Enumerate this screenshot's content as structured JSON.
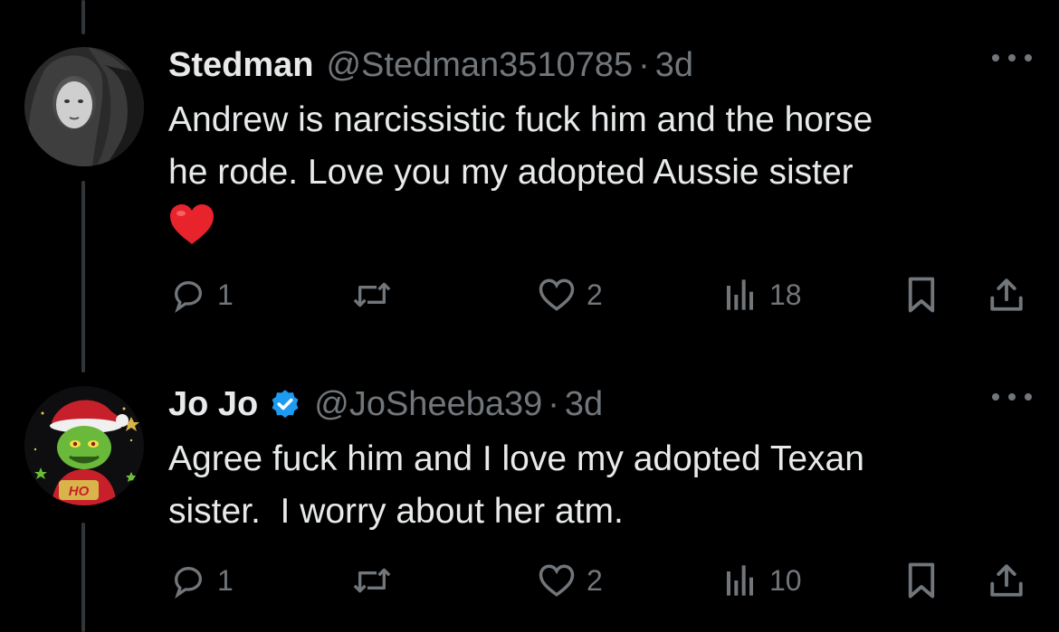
{
  "tweets": [
    {
      "name": "Stedman",
      "handle": "@Stedman3510785",
      "separator": "·",
      "time": "3d",
      "text_lines": [
        "Andrew is narcissistic fuck him and the horse",
        "he rode. Love you my adopted Aussie sister"
      ],
      "emoji": "❤️",
      "verified": false,
      "avatar_icon": "woman-with-horse-avatar",
      "replies": "1",
      "likes": "2",
      "views": "18"
    },
    {
      "name": "Jo Jo",
      "handle": "@JoSheeba39",
      "separator": "·",
      "time": "3d",
      "text_lines": [
        "Agree fuck him and I love my adopted Texan",
        "sister.  I worry about her atm."
      ],
      "verified": true,
      "avatar_icon": "grinch-santa-avatar",
      "avatar_text": "HO",
      "replies": "1",
      "likes": "2",
      "views": "10"
    }
  ],
  "colors": {
    "background": "#000000",
    "text": "#e7e9ea",
    "muted": "#71767b",
    "verified": "#1d9bf0",
    "heart": "#f91880"
  }
}
